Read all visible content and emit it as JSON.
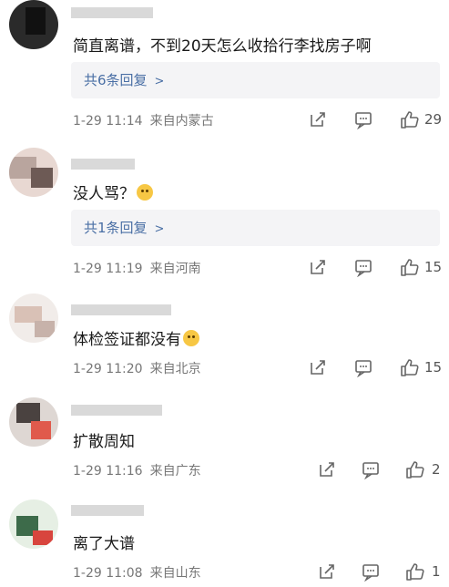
{
  "comments": [
    {
      "content": "简直离谱，不到20天怎么收拾行李找房子啊",
      "replies": "共6条回复",
      "time": "1-29 11:14",
      "location": "来自内蒙古",
      "likes": "29"
    },
    {
      "content": "没人骂？",
      "replies": "共1条回复",
      "time": "1-29 11:19",
      "location": "来自河南",
      "likes": "15"
    },
    {
      "content": "体检签证都没有",
      "time": "1-29 11:20",
      "location": "来自北京",
      "likes": "15"
    },
    {
      "content": "扩散周知",
      "time": "1-29 11:16",
      "location": "来自广东",
      "likes": "2"
    },
    {
      "content": "离了大谱",
      "time": "1-29 11:08",
      "location": "来自山东",
      "likes": "1"
    }
  ],
  "icons": {
    "share": "share-icon",
    "comment": "comment-icon",
    "like": "thumbs-up-icon",
    "replies_chevron": "chevron-right-icon"
  },
  "colors": {
    "reply_link": "#4a6fa5",
    "reply_bg": "#f4f4f6",
    "meta_text": "#777777"
  }
}
